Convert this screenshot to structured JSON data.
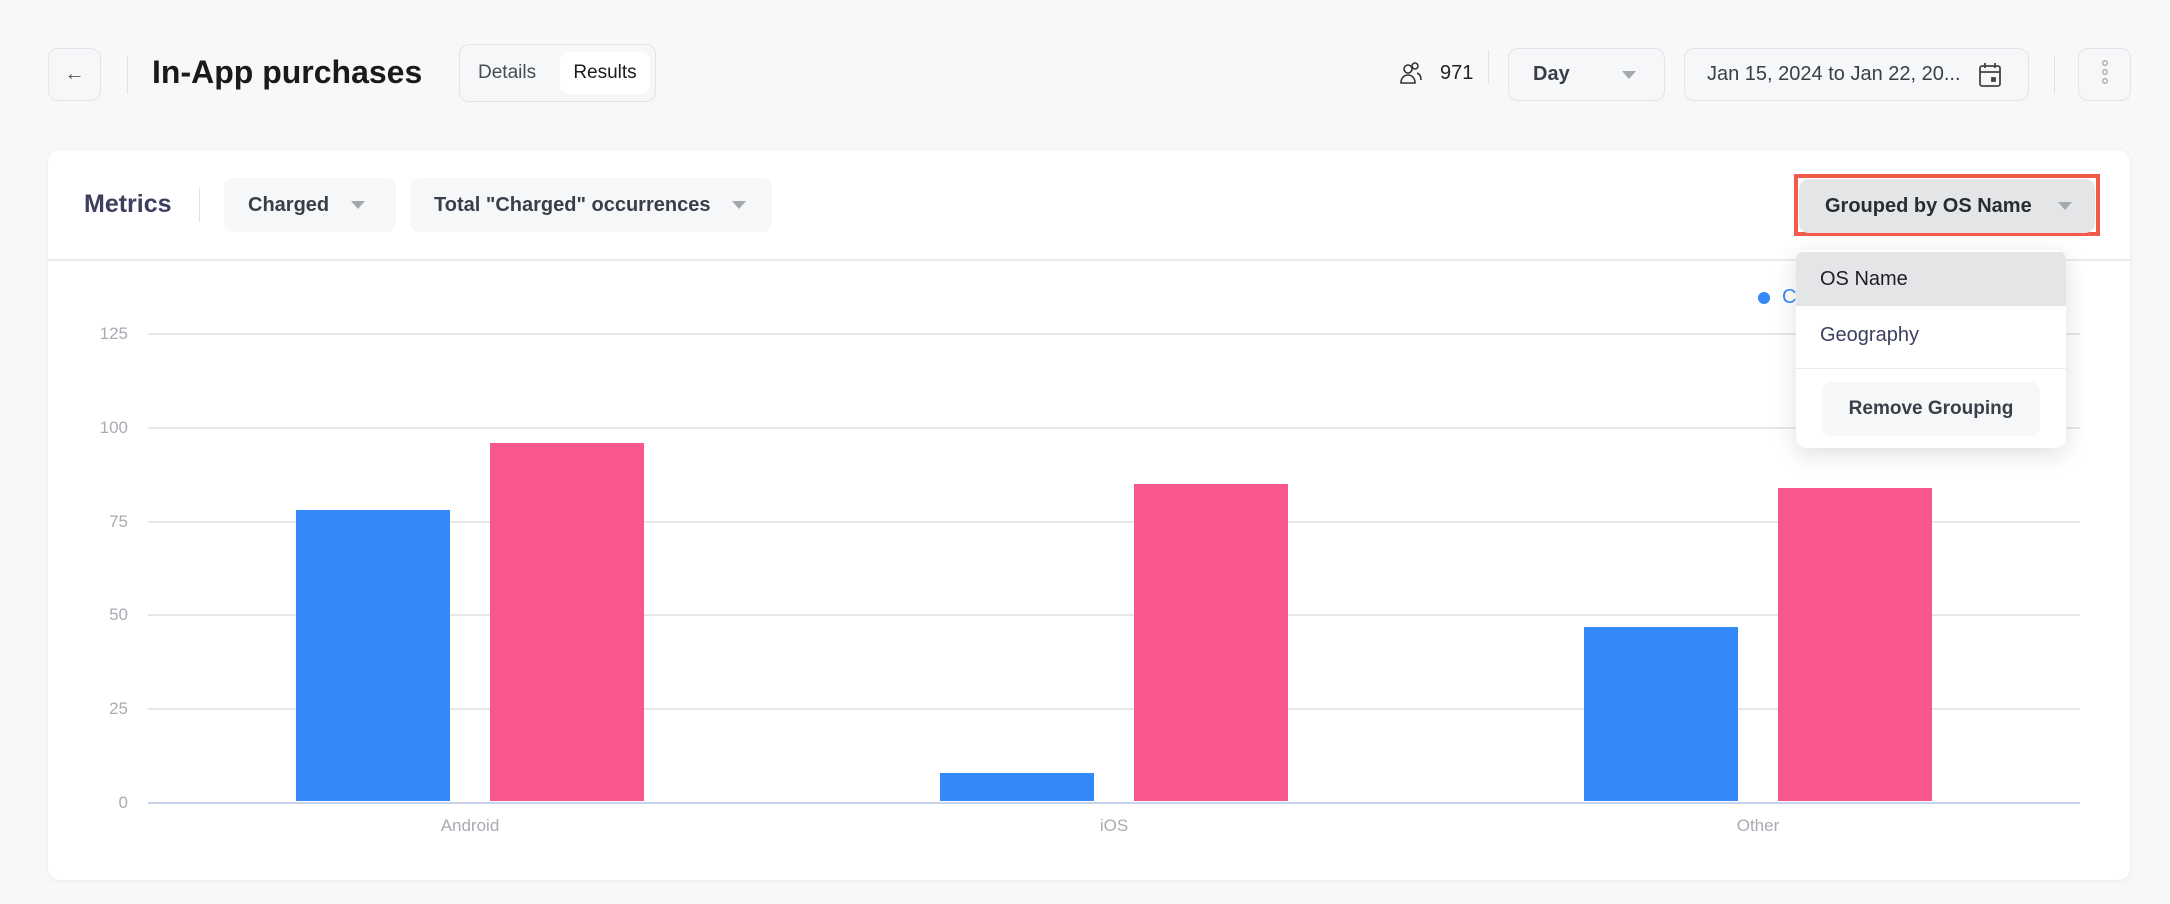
{
  "header": {
    "title": "In-App purchases",
    "tabs": [
      {
        "label": "Details",
        "active": false
      },
      {
        "label": "Results",
        "active": true
      }
    ],
    "users_count": "971",
    "granularity": "Day",
    "date_range": "Jan 15, 2024 to Jan 22, 20..."
  },
  "metrics": {
    "label": "Metrics",
    "event": "Charged",
    "measure": "Total \"Charged\" occurrences",
    "group_button": "Grouped by OS Name"
  },
  "group_menu": {
    "items": [
      {
        "label": "OS Name",
        "selected": true
      },
      {
        "label": "Geography",
        "selected": false
      }
    ],
    "remove_label": "Remove Grouping"
  },
  "legend": {
    "partial_text": "C"
  },
  "colors": {
    "series_1": "#3388fa",
    "series_2": "#f7568f",
    "highlight_border": "#f25a4b"
  },
  "chart_data": {
    "type": "bar",
    "categories": [
      "Android",
      "iOS",
      "Other"
    ],
    "series": [
      {
        "values": [
          78,
          8,
          47
        ]
      },
      {
        "values": [
          96,
          85,
          84
        ]
      }
    ],
    "ylim": [
      0,
      125
    ],
    "yticks": [
      "0",
      "25",
      "50",
      "75",
      "100",
      "125"
    ],
    "grid": true,
    "legend": "top-right"
  }
}
